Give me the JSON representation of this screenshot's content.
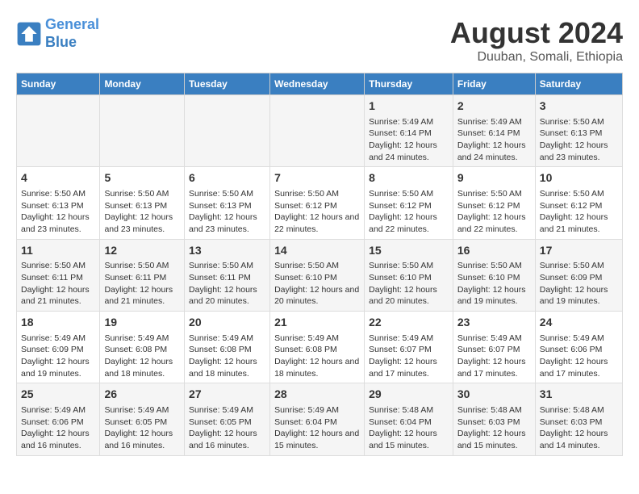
{
  "header": {
    "logo_line1": "General",
    "logo_line2": "Blue",
    "main_title": "August 2024",
    "subtitle": "Duuban, Somali, Ethiopia"
  },
  "columns": [
    "Sunday",
    "Monday",
    "Tuesday",
    "Wednesday",
    "Thursday",
    "Friday",
    "Saturday"
  ],
  "weeks": [
    [
      {
        "day": "",
        "info": ""
      },
      {
        "day": "",
        "info": ""
      },
      {
        "day": "",
        "info": ""
      },
      {
        "day": "",
        "info": ""
      },
      {
        "day": "1",
        "info": "Sunrise: 5:49 AM\nSunset: 6:14 PM\nDaylight: 12 hours and 24 minutes."
      },
      {
        "day": "2",
        "info": "Sunrise: 5:49 AM\nSunset: 6:14 PM\nDaylight: 12 hours and 24 minutes."
      },
      {
        "day": "3",
        "info": "Sunrise: 5:50 AM\nSunset: 6:13 PM\nDaylight: 12 hours and 23 minutes."
      }
    ],
    [
      {
        "day": "4",
        "info": "Sunrise: 5:50 AM\nSunset: 6:13 PM\nDaylight: 12 hours and 23 minutes."
      },
      {
        "day": "5",
        "info": "Sunrise: 5:50 AM\nSunset: 6:13 PM\nDaylight: 12 hours and 23 minutes."
      },
      {
        "day": "6",
        "info": "Sunrise: 5:50 AM\nSunset: 6:13 PM\nDaylight: 12 hours and 23 minutes."
      },
      {
        "day": "7",
        "info": "Sunrise: 5:50 AM\nSunset: 6:12 PM\nDaylight: 12 hours and 22 minutes."
      },
      {
        "day": "8",
        "info": "Sunrise: 5:50 AM\nSunset: 6:12 PM\nDaylight: 12 hours and 22 minutes."
      },
      {
        "day": "9",
        "info": "Sunrise: 5:50 AM\nSunset: 6:12 PM\nDaylight: 12 hours and 22 minutes."
      },
      {
        "day": "10",
        "info": "Sunrise: 5:50 AM\nSunset: 6:12 PM\nDaylight: 12 hours and 21 minutes."
      }
    ],
    [
      {
        "day": "11",
        "info": "Sunrise: 5:50 AM\nSunset: 6:11 PM\nDaylight: 12 hours and 21 minutes."
      },
      {
        "day": "12",
        "info": "Sunrise: 5:50 AM\nSunset: 6:11 PM\nDaylight: 12 hours and 21 minutes."
      },
      {
        "day": "13",
        "info": "Sunrise: 5:50 AM\nSunset: 6:11 PM\nDaylight: 12 hours and 20 minutes."
      },
      {
        "day": "14",
        "info": "Sunrise: 5:50 AM\nSunset: 6:10 PM\nDaylight: 12 hours and 20 minutes."
      },
      {
        "day": "15",
        "info": "Sunrise: 5:50 AM\nSunset: 6:10 PM\nDaylight: 12 hours and 20 minutes."
      },
      {
        "day": "16",
        "info": "Sunrise: 5:50 AM\nSunset: 6:10 PM\nDaylight: 12 hours and 19 minutes."
      },
      {
        "day": "17",
        "info": "Sunrise: 5:50 AM\nSunset: 6:09 PM\nDaylight: 12 hours and 19 minutes."
      }
    ],
    [
      {
        "day": "18",
        "info": "Sunrise: 5:49 AM\nSunset: 6:09 PM\nDaylight: 12 hours and 19 minutes."
      },
      {
        "day": "19",
        "info": "Sunrise: 5:49 AM\nSunset: 6:08 PM\nDaylight: 12 hours and 18 minutes."
      },
      {
        "day": "20",
        "info": "Sunrise: 5:49 AM\nSunset: 6:08 PM\nDaylight: 12 hours and 18 minutes."
      },
      {
        "day": "21",
        "info": "Sunrise: 5:49 AM\nSunset: 6:08 PM\nDaylight: 12 hours and 18 minutes."
      },
      {
        "day": "22",
        "info": "Sunrise: 5:49 AM\nSunset: 6:07 PM\nDaylight: 12 hours and 17 minutes."
      },
      {
        "day": "23",
        "info": "Sunrise: 5:49 AM\nSunset: 6:07 PM\nDaylight: 12 hours and 17 minutes."
      },
      {
        "day": "24",
        "info": "Sunrise: 5:49 AM\nSunset: 6:06 PM\nDaylight: 12 hours and 17 minutes."
      }
    ],
    [
      {
        "day": "25",
        "info": "Sunrise: 5:49 AM\nSunset: 6:06 PM\nDaylight: 12 hours and 16 minutes."
      },
      {
        "day": "26",
        "info": "Sunrise: 5:49 AM\nSunset: 6:05 PM\nDaylight: 12 hours and 16 minutes."
      },
      {
        "day": "27",
        "info": "Sunrise: 5:49 AM\nSunset: 6:05 PM\nDaylight: 12 hours and 16 minutes."
      },
      {
        "day": "28",
        "info": "Sunrise: 5:49 AM\nSunset: 6:04 PM\nDaylight: 12 hours and 15 minutes."
      },
      {
        "day": "29",
        "info": "Sunrise: 5:48 AM\nSunset: 6:04 PM\nDaylight: 12 hours and 15 minutes."
      },
      {
        "day": "30",
        "info": "Sunrise: 5:48 AM\nSunset: 6:03 PM\nDaylight: 12 hours and 15 minutes."
      },
      {
        "day": "31",
        "info": "Sunrise: 5:48 AM\nSunset: 6:03 PM\nDaylight: 12 hours and 14 minutes."
      }
    ]
  ]
}
